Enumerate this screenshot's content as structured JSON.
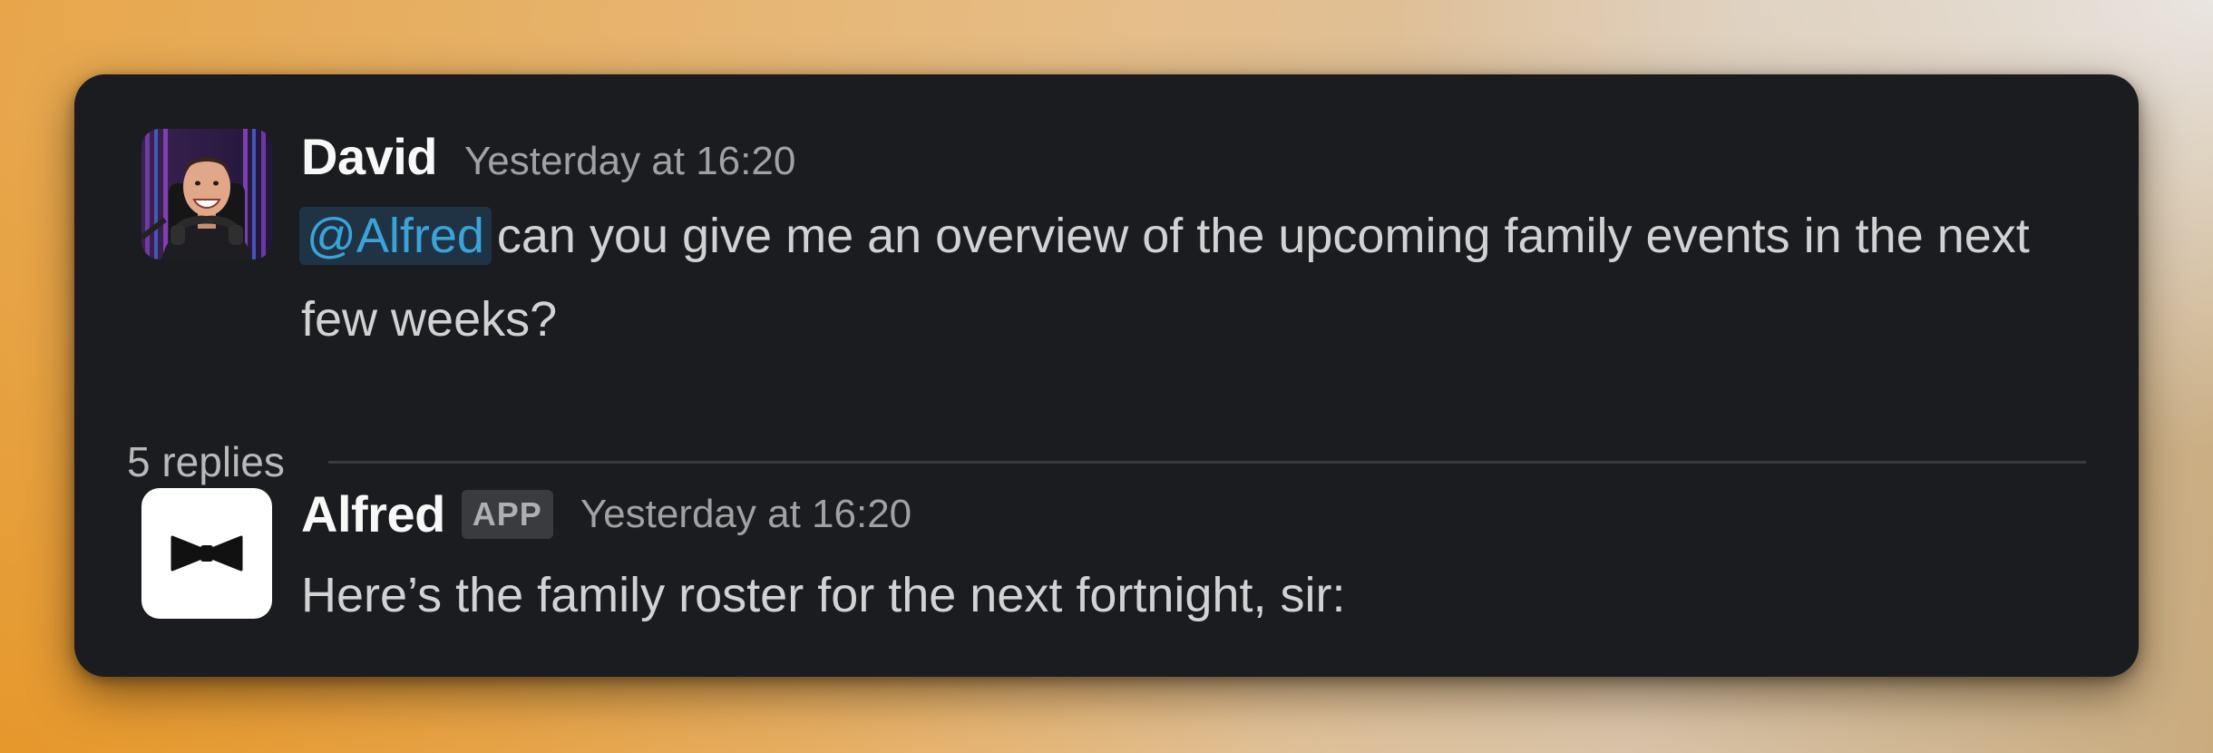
{
  "thread": {
    "original_message": {
      "author": "David",
      "timestamp": "Yesterday at 16:20",
      "mention": "@Alfred",
      "text": "can you give me an overview of the upcoming family events in the next few weeks?"
    },
    "replies_count_label": "5 replies",
    "reply": {
      "author": "Alfred",
      "badge": "APP",
      "timestamp": "Yesterday at 16:20",
      "text": "Here’s the family roster for the next fortnight, sir:"
    }
  },
  "colors": {
    "card_background": "#1b1c1f",
    "mention_text": "#3aa3d8",
    "mention_background": "#1f3344",
    "author_text": "#f8f8f8",
    "timestamp_text": "#a0a1a3"
  },
  "icons": {
    "david_avatar": "user-photo-avatar",
    "alfred_avatar": "bow-tie-icon"
  }
}
